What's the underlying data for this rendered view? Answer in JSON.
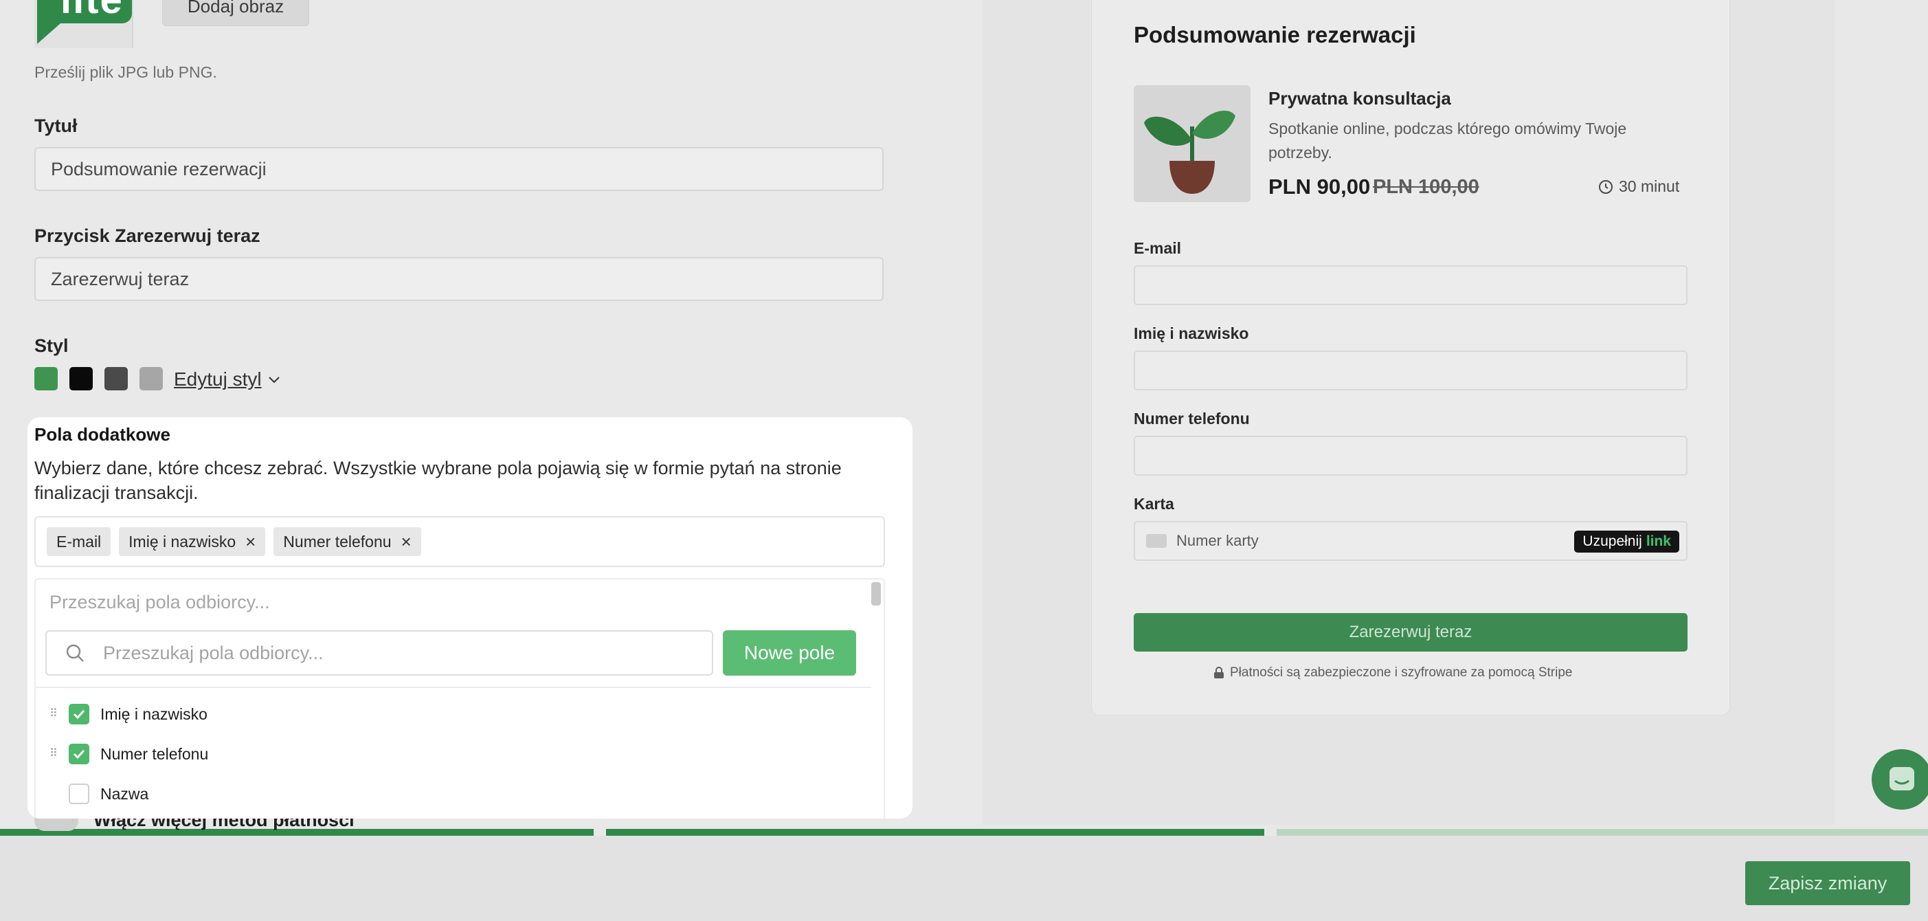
{
  "settings": {
    "add_image_button": "Dodaj obraz",
    "upload_hint": "Prześlij plik JPG lub PNG.",
    "title_label": "Tytuł",
    "title_value": "Podsumowanie rezerwacji",
    "book_button_label": "Przycisk Zarezerwuj teraz",
    "book_button_value": "Zarezerwuj teraz",
    "style_label": "Styl",
    "edit_style": "Edytuj styl",
    "swatches": [
      "#3f9450",
      "#0a0a0a",
      "#4a4a4a",
      "#a6a6a6"
    ],
    "more_payments": "Włącz więcej metod płatności"
  },
  "preview": {
    "title": "Podsumowanie rezerwacji",
    "product_name": "Prywatna konsultacja",
    "product_desc": "Spotkanie online, podczas którego omówimy Twoje potrzeby.",
    "price_new": "PLN 90,00",
    "price_old": "PLN 100,00",
    "duration": "30 minut",
    "fields": {
      "email": "E-mail",
      "name": "Imię i nazwisko",
      "phone": "Numer telefonu",
      "card": "Karta"
    },
    "card_placeholder": "Numer karty",
    "link_prefix": "Uzupełnij",
    "link_brand": "link",
    "book_button": "Zarezerwuj teraz",
    "secure_note": "Płatności są zabezpieczone i szyfrowane za pomocą Stripe"
  },
  "modal": {
    "title": "Pola dodatkowe",
    "description": "Wybierz dane, które chcesz zebrać. Wszystkie wybrane pola pojawią się w formie pytań na stronie finalizacji transakcji.",
    "tags": [
      {
        "label": "E-mail",
        "removable": false
      },
      {
        "label": "Imię i nazwisko",
        "removable": true
      },
      {
        "label": "Numer telefonu",
        "removable": true
      }
    ],
    "search_placeholder": "Przeszukaj pola odbiorcy...",
    "new_field_button": "Nowe pole",
    "options": [
      {
        "label": "Imię i nazwisko",
        "checked": true
      },
      {
        "label": "Numer telefonu",
        "checked": true
      },
      {
        "label": "Nazwa",
        "checked": false
      }
    ]
  },
  "footer": {
    "save_button": "Zapisz zmiany",
    "progress_steps": 3,
    "progress_complete": 2
  },
  "colors": {
    "brand_green": "#3d8a52",
    "checkbox_green": "#4fb86a",
    "new_field_green": "#5bbd74"
  },
  "icons": {
    "search": "search-icon",
    "clock": "clock-icon",
    "lock": "lock-icon",
    "chevron": "chevron-down-icon",
    "chat": "chat-icon",
    "check": "check-icon",
    "close": "close-icon",
    "drag": "drag-handle-icon"
  }
}
